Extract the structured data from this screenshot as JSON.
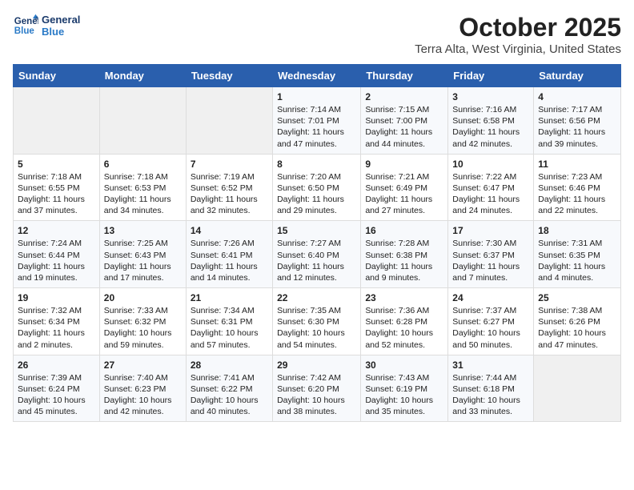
{
  "header": {
    "logo_line1": "General",
    "logo_line2": "Blue",
    "title": "October 2025",
    "subtitle": "Terra Alta, West Virginia, United States"
  },
  "days_of_week": [
    "Sunday",
    "Monday",
    "Tuesday",
    "Wednesday",
    "Thursday",
    "Friday",
    "Saturday"
  ],
  "weeks": [
    [
      {
        "day": "",
        "content": ""
      },
      {
        "day": "",
        "content": ""
      },
      {
        "day": "",
        "content": ""
      },
      {
        "day": "1",
        "content": "Sunrise: 7:14 AM\nSunset: 7:01 PM\nDaylight: 11 hours and 47 minutes."
      },
      {
        "day": "2",
        "content": "Sunrise: 7:15 AM\nSunset: 7:00 PM\nDaylight: 11 hours and 44 minutes."
      },
      {
        "day": "3",
        "content": "Sunrise: 7:16 AM\nSunset: 6:58 PM\nDaylight: 11 hours and 42 minutes."
      },
      {
        "day": "4",
        "content": "Sunrise: 7:17 AM\nSunset: 6:56 PM\nDaylight: 11 hours and 39 minutes."
      }
    ],
    [
      {
        "day": "5",
        "content": "Sunrise: 7:18 AM\nSunset: 6:55 PM\nDaylight: 11 hours and 37 minutes."
      },
      {
        "day": "6",
        "content": "Sunrise: 7:18 AM\nSunset: 6:53 PM\nDaylight: 11 hours and 34 minutes."
      },
      {
        "day": "7",
        "content": "Sunrise: 7:19 AM\nSunset: 6:52 PM\nDaylight: 11 hours and 32 minutes."
      },
      {
        "day": "8",
        "content": "Sunrise: 7:20 AM\nSunset: 6:50 PM\nDaylight: 11 hours and 29 minutes."
      },
      {
        "day": "9",
        "content": "Sunrise: 7:21 AM\nSunset: 6:49 PM\nDaylight: 11 hours and 27 minutes."
      },
      {
        "day": "10",
        "content": "Sunrise: 7:22 AM\nSunset: 6:47 PM\nDaylight: 11 hours and 24 minutes."
      },
      {
        "day": "11",
        "content": "Sunrise: 7:23 AM\nSunset: 6:46 PM\nDaylight: 11 hours and 22 minutes."
      }
    ],
    [
      {
        "day": "12",
        "content": "Sunrise: 7:24 AM\nSunset: 6:44 PM\nDaylight: 11 hours and 19 minutes."
      },
      {
        "day": "13",
        "content": "Sunrise: 7:25 AM\nSunset: 6:43 PM\nDaylight: 11 hours and 17 minutes."
      },
      {
        "day": "14",
        "content": "Sunrise: 7:26 AM\nSunset: 6:41 PM\nDaylight: 11 hours and 14 minutes."
      },
      {
        "day": "15",
        "content": "Sunrise: 7:27 AM\nSunset: 6:40 PM\nDaylight: 11 hours and 12 minutes."
      },
      {
        "day": "16",
        "content": "Sunrise: 7:28 AM\nSunset: 6:38 PM\nDaylight: 11 hours and 9 minutes."
      },
      {
        "day": "17",
        "content": "Sunrise: 7:30 AM\nSunset: 6:37 PM\nDaylight: 11 hours and 7 minutes."
      },
      {
        "day": "18",
        "content": "Sunrise: 7:31 AM\nSunset: 6:35 PM\nDaylight: 11 hours and 4 minutes."
      }
    ],
    [
      {
        "day": "19",
        "content": "Sunrise: 7:32 AM\nSunset: 6:34 PM\nDaylight: 11 hours and 2 minutes."
      },
      {
        "day": "20",
        "content": "Sunrise: 7:33 AM\nSunset: 6:32 PM\nDaylight: 10 hours and 59 minutes."
      },
      {
        "day": "21",
        "content": "Sunrise: 7:34 AM\nSunset: 6:31 PM\nDaylight: 10 hours and 57 minutes."
      },
      {
        "day": "22",
        "content": "Sunrise: 7:35 AM\nSunset: 6:30 PM\nDaylight: 10 hours and 54 minutes."
      },
      {
        "day": "23",
        "content": "Sunrise: 7:36 AM\nSunset: 6:28 PM\nDaylight: 10 hours and 52 minutes."
      },
      {
        "day": "24",
        "content": "Sunrise: 7:37 AM\nSunset: 6:27 PM\nDaylight: 10 hours and 50 minutes."
      },
      {
        "day": "25",
        "content": "Sunrise: 7:38 AM\nSunset: 6:26 PM\nDaylight: 10 hours and 47 minutes."
      }
    ],
    [
      {
        "day": "26",
        "content": "Sunrise: 7:39 AM\nSunset: 6:24 PM\nDaylight: 10 hours and 45 minutes."
      },
      {
        "day": "27",
        "content": "Sunrise: 7:40 AM\nSunset: 6:23 PM\nDaylight: 10 hours and 42 minutes."
      },
      {
        "day": "28",
        "content": "Sunrise: 7:41 AM\nSunset: 6:22 PM\nDaylight: 10 hours and 40 minutes."
      },
      {
        "day": "29",
        "content": "Sunrise: 7:42 AM\nSunset: 6:20 PM\nDaylight: 10 hours and 38 minutes."
      },
      {
        "day": "30",
        "content": "Sunrise: 7:43 AM\nSunset: 6:19 PM\nDaylight: 10 hours and 35 minutes."
      },
      {
        "day": "31",
        "content": "Sunrise: 7:44 AM\nSunset: 6:18 PM\nDaylight: 10 hours and 33 minutes."
      },
      {
        "day": "",
        "content": ""
      }
    ]
  ]
}
